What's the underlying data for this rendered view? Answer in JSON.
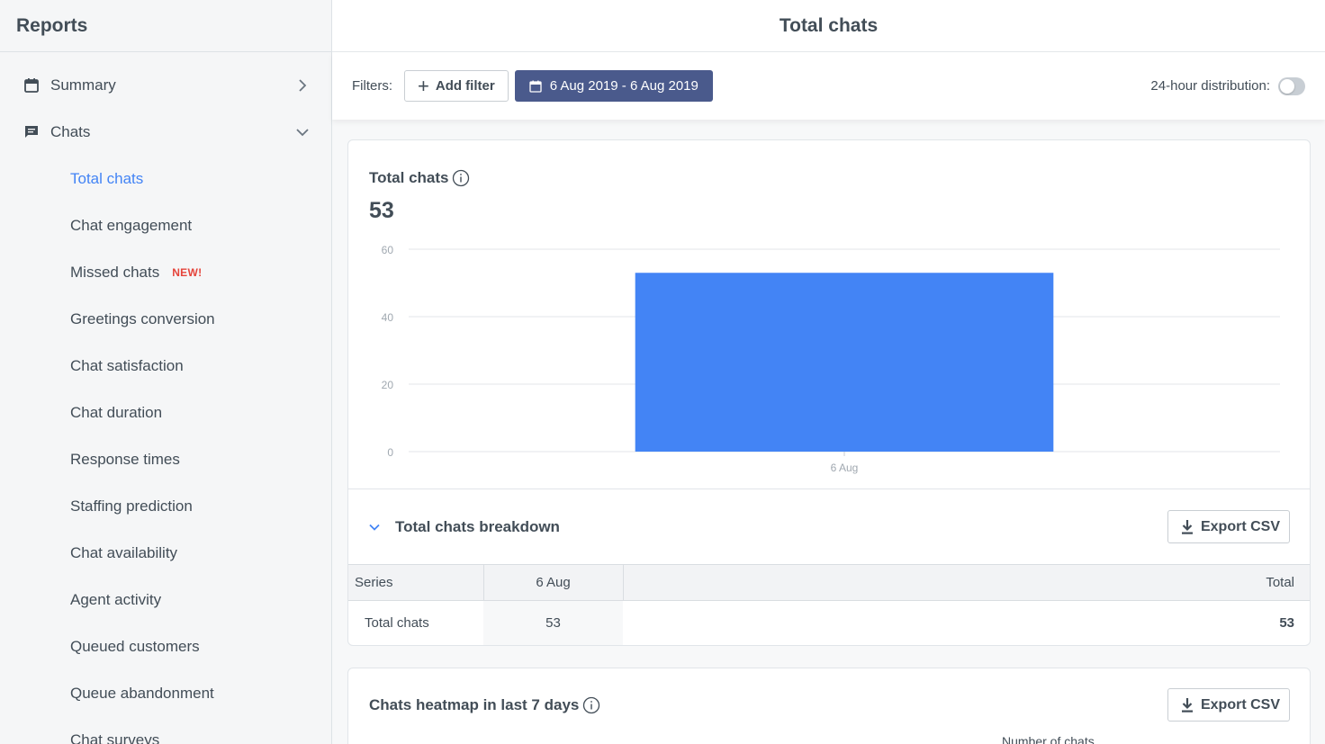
{
  "sidebar": {
    "title": "Reports",
    "groups": [
      {
        "label": "Summary",
        "icon": "calendar-icon"
      },
      {
        "label": "Chats",
        "icon": "chat-bubble-icon"
      }
    ],
    "items": [
      {
        "label": "Total chats",
        "active": true
      },
      {
        "label": "Chat engagement"
      },
      {
        "label": "Missed chats",
        "badge": "NEW!"
      },
      {
        "label": "Greetings conversion"
      },
      {
        "label": "Chat satisfaction"
      },
      {
        "label": "Chat duration"
      },
      {
        "label": "Response times"
      },
      {
        "label": "Staffing prediction"
      },
      {
        "label": "Chat availability"
      },
      {
        "label": "Agent activity"
      },
      {
        "label": "Queued customers"
      },
      {
        "label": "Queue abandonment"
      },
      {
        "label": "Chat surveys"
      }
    ]
  },
  "header": {
    "title": "Total chats"
  },
  "filters": {
    "label": "Filters:",
    "add_filter": "Add filter",
    "date_range": "6 Aug 2019 - 6 Aug 2019",
    "distribution_label": "24-hour distribution:",
    "distribution_on": false
  },
  "report": {
    "title": "Total chats",
    "total": "53",
    "breakdown_title": "Total chats breakdown",
    "export_label": "Export CSV",
    "table": {
      "headers": [
        "Series",
        "6 Aug",
        "Total"
      ],
      "rows": [
        [
          "Total chats",
          "53",
          "53"
        ]
      ]
    }
  },
  "heatmap": {
    "title": "Chats heatmap in last 7 days",
    "export_label": "Export CSV",
    "subtitle": "Number of chats"
  },
  "colors": {
    "accent": "#4384f5",
    "bar": "#4384f5",
    "date_button": "#4a5a8c",
    "new_badge": "#e5443b"
  },
  "chart_data": {
    "type": "bar",
    "categories": [
      "6 Aug"
    ],
    "values": [
      53
    ],
    "ylim": [
      0,
      60
    ],
    "yticks": [
      0,
      20,
      40,
      60
    ],
    "grid": true
  }
}
